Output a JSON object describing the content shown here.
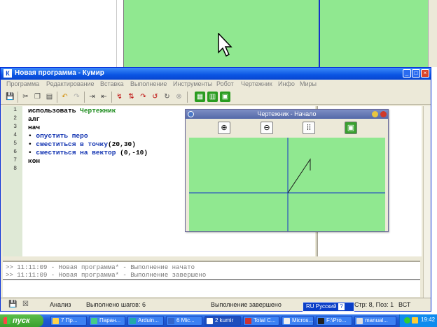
{
  "window": {
    "title": "Новая программа - Кумир",
    "icon_letter": "К",
    "controls": [
      "_",
      "□",
      "×"
    ]
  },
  "menu": [
    "Программа",
    "Редактирование",
    "Вставка",
    "Выполнение",
    "Инструменты",
    "Робот",
    "Чертежник",
    "Инфо",
    "Миры"
  ],
  "editor": {
    "line_numbers": [
      "1",
      "2",
      "3",
      "4",
      "5",
      "6",
      "7",
      "8"
    ],
    "lines": {
      "l1_kw": "использовать",
      "l1_mod": "Чертежник",
      "l2": "алг",
      "l3": "нач",
      "l4_bullet": "•",
      "l4": "опустить перо",
      "l5_bullet": "•",
      "l5_cmd": "сместиться в точку",
      "l5_args": "(20,30)",
      "l6_bullet": "•",
      "l6_cmd": "сместиться на вектор",
      "l6_args": "(0,-10)",
      "l7": "кон"
    }
  },
  "output": {
    "line1": ">> 11:11:09 - Новая программа* - Выполнение начато",
    "line2": ">> 11:11:09 - Новая программа* - Выполнение завершено"
  },
  "status": {
    "mode": "Анализ",
    "steps": "Выполнено шагов: 6",
    "state": "Выполнение завершено",
    "position": "Стр: 8, Поз: 1",
    "insert": "ВСТ"
  },
  "drawer": {
    "title": "Чертежник - Начало",
    "tools": [
      "zoom-in-icon",
      "zoom-out-icon",
      "grid-icon",
      "fit-icon"
    ],
    "colors": {
      "canvas": "#90e890",
      "axis": "#1533c8",
      "pen": "#1a1a1a"
    },
    "path": [
      [
        0,
        0
      ],
      [
        20,
        30
      ],
      [
        20,
        20
      ]
    ]
  },
  "language_bar": {
    "label": "RU Русский",
    "help": "?"
  },
  "taskbar": {
    "start": "пуск",
    "tasks": [
      "7 Пр...",
      "Паран...",
      "Arduin...",
      "6 Mic...",
      "2 kumir",
      "Total C...",
      "Micros...",
      "F:\\Pro...",
      "manual..."
    ],
    "clock": "19:42"
  }
}
